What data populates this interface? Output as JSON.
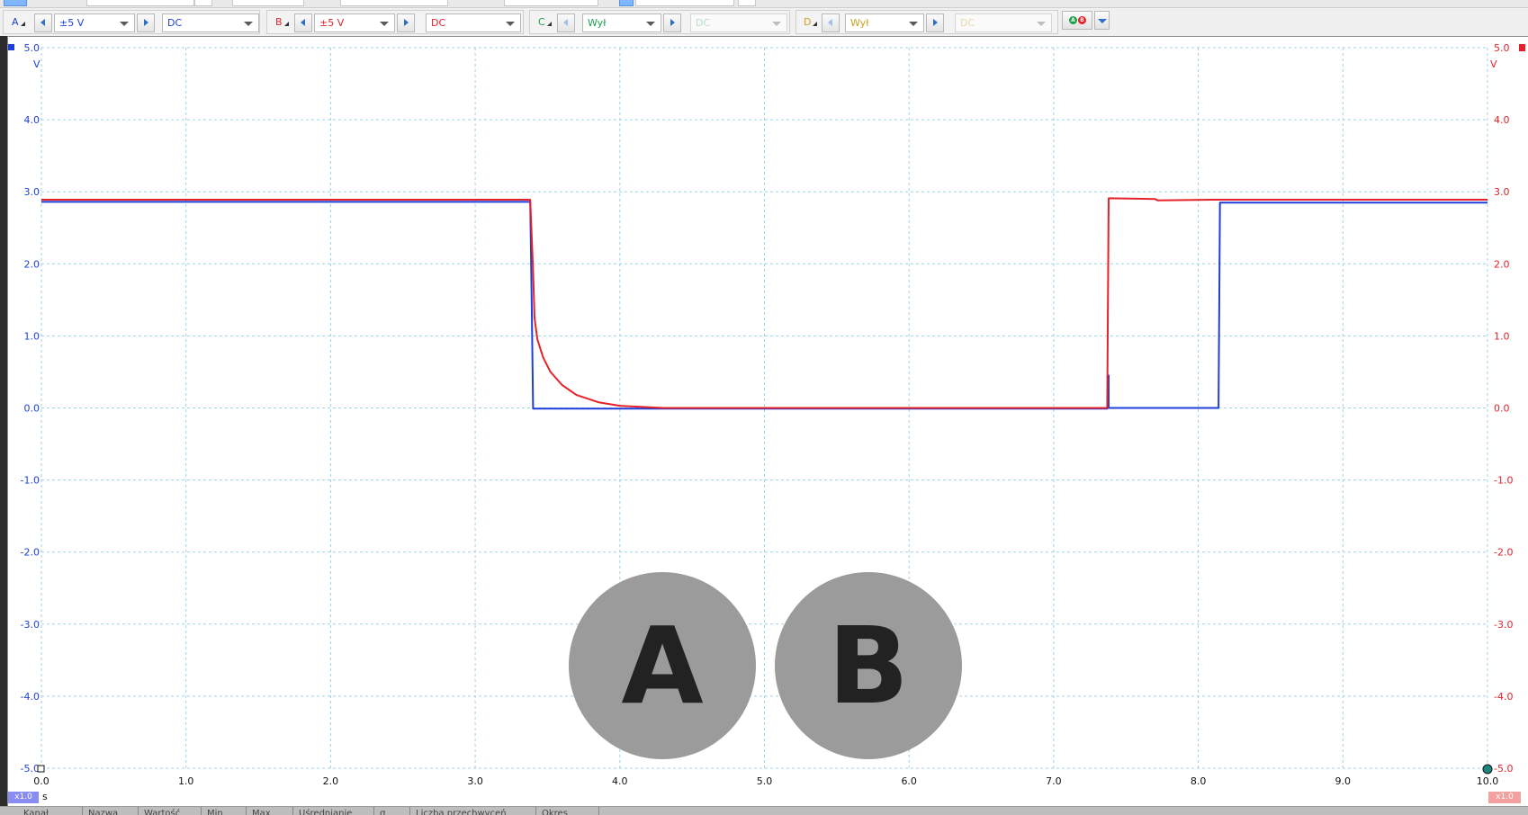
{
  "channel_toolbar": {
    "channels": [
      {
        "letter": "A",
        "letter_color": "#1e3fd8",
        "range": "±5 V",
        "range_color": "#1e3fd8",
        "coupling": "DC",
        "coupling_color": "#1e3fd8",
        "enabled": true
      },
      {
        "letter": "B",
        "letter_color": "#e5222a",
        "range": "±5 V",
        "range_color": "#e5222a",
        "coupling": "DC",
        "coupling_color": "#e5222a",
        "enabled": true
      },
      {
        "letter": "C",
        "letter_color": "#1aa04a",
        "range": "Wył",
        "range_color": "#1aa04a",
        "coupling": "DC",
        "coupling_color": "#b7dfc4",
        "enabled": false
      },
      {
        "letter": "D",
        "letter_color": "#c9a020",
        "range": "Wył",
        "range_color": "#c9a020",
        "coupling": "DC",
        "coupling_color": "#ead9a6",
        "enabled": false
      }
    ],
    "extras_dots": [
      {
        "label": "A",
        "color": "#1aa04a"
      },
      {
        "label": "B",
        "color": "#e5222a"
      }
    ]
  },
  "scope": {
    "watermarks": [
      "A",
      "B"
    ],
    "left_unit": "V",
    "right_unit": "V",
    "x_unit": "s",
    "left_scale_badge": "x1.0",
    "right_scale_badge": "x1.0",
    "colors": {
      "grid": "#9fd1e6",
      "channel_a": "#1e3fd8",
      "channel_b": "#e5222a",
      "badge_left": "#8a8cf3",
      "badge_right": "#f3a0a0"
    }
  },
  "chart_data": {
    "type": "line",
    "title": "",
    "xlabel": "s",
    "ylabel": "V",
    "xlim": [
      0.0,
      10.0
    ],
    "ylim": [
      -5.0,
      5.0
    ],
    "x_ticks": [
      "0.0",
      "1.0",
      "2.0",
      "3.0",
      "4.0",
      "5.0",
      "6.0",
      "7.0",
      "8.0",
      "9.0",
      "10.0"
    ],
    "y_ticks_left": [
      "5.0",
      "4.0",
      "3.0",
      "2.0",
      "1.0",
      "0.0",
      "-1.0",
      "-2.0",
      "-3.0",
      "-4.0",
      "-5.0"
    ],
    "y_ticks_right": [
      "5.0",
      "4.0",
      "3.0",
      "2.0",
      "1.0",
      "0.0",
      "-1.0",
      "-2.0",
      "-3.0",
      "-4.0",
      "-5.0"
    ],
    "grid": true,
    "series": [
      {
        "name": "A",
        "color": "#1e3fd8",
        "x": [
          0.0,
          3.38,
          3.39,
          3.4,
          7.37,
          7.38,
          7.38,
          7.7,
          8.14,
          8.15,
          10.0
        ],
        "y": [
          2.86,
          2.86,
          1.5,
          -0.01,
          -0.01,
          0.45,
          0.0,
          0.0,
          0.0,
          2.85,
          2.85
        ]
      },
      {
        "name": "B",
        "color": "#e5222a",
        "x": [
          0.0,
          3.38,
          3.4,
          3.41,
          3.43,
          3.47,
          3.52,
          3.6,
          3.7,
          3.85,
          4.0,
          4.3,
          4.6,
          7.37,
          7.38,
          7.7,
          7.72,
          8.1,
          10.0
        ],
        "y": [
          2.89,
          2.89,
          1.9,
          1.25,
          0.95,
          0.7,
          0.5,
          0.32,
          0.18,
          0.08,
          0.03,
          0.0,
          0.0,
          0.0,
          2.91,
          2.9,
          2.88,
          2.89,
          2.89
        ]
      }
    ]
  },
  "measure_tabs": [
    "Kanał",
    "Nazwa",
    "Wartość",
    "Min",
    "Max",
    "Uśrednianie",
    "σ",
    "Liczba przechwyceń",
    "Okres"
  ]
}
